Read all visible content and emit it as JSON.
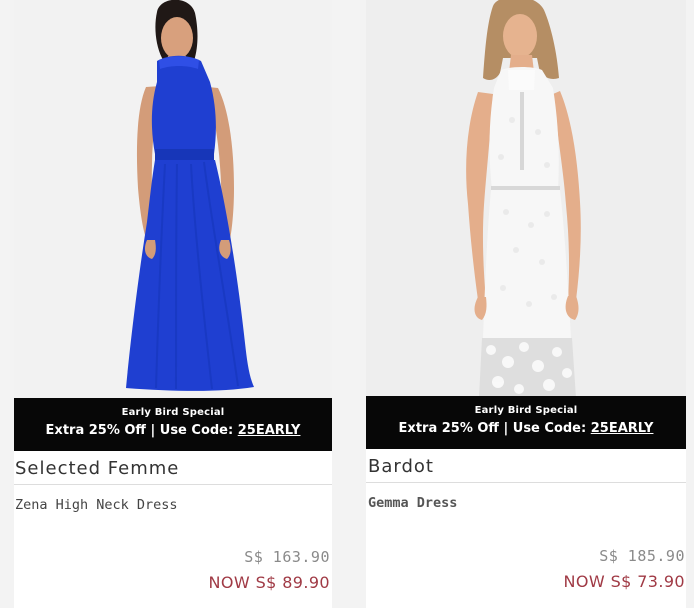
{
  "colors": {
    "promo_background": "#070707",
    "promo_text": "#ffffff",
    "brand_text": "#333333",
    "sale_price": "#a03a45",
    "old_price": "#8a8a8a",
    "left_dress": "#1f3fd1",
    "right_dress": "#f7f7f7"
  },
  "products": [
    {
      "image_icon": "model-wearing-blue-high-neck-dress",
      "promo": {
        "title": "Early Bird Special",
        "line": "Extra 25% Off | Use Code:",
        "code": "25EARLY"
      },
      "brand": "Selected Femme",
      "name": "Zena High Neck Dress",
      "old_price": "S$ 163.90",
      "now_price": "NOW S$ 89.90"
    },
    {
      "image_icon": "model-wearing-white-lace-halter-dress",
      "promo": {
        "title": "Early Bird Special",
        "line": "Extra 25% Off | Use Code:",
        "code": "25EARLY"
      },
      "brand": "Bardot",
      "name": "Gemma Dress",
      "old_price": "S$ 185.90",
      "now_price": "NOW S$ 73.90"
    }
  ]
}
